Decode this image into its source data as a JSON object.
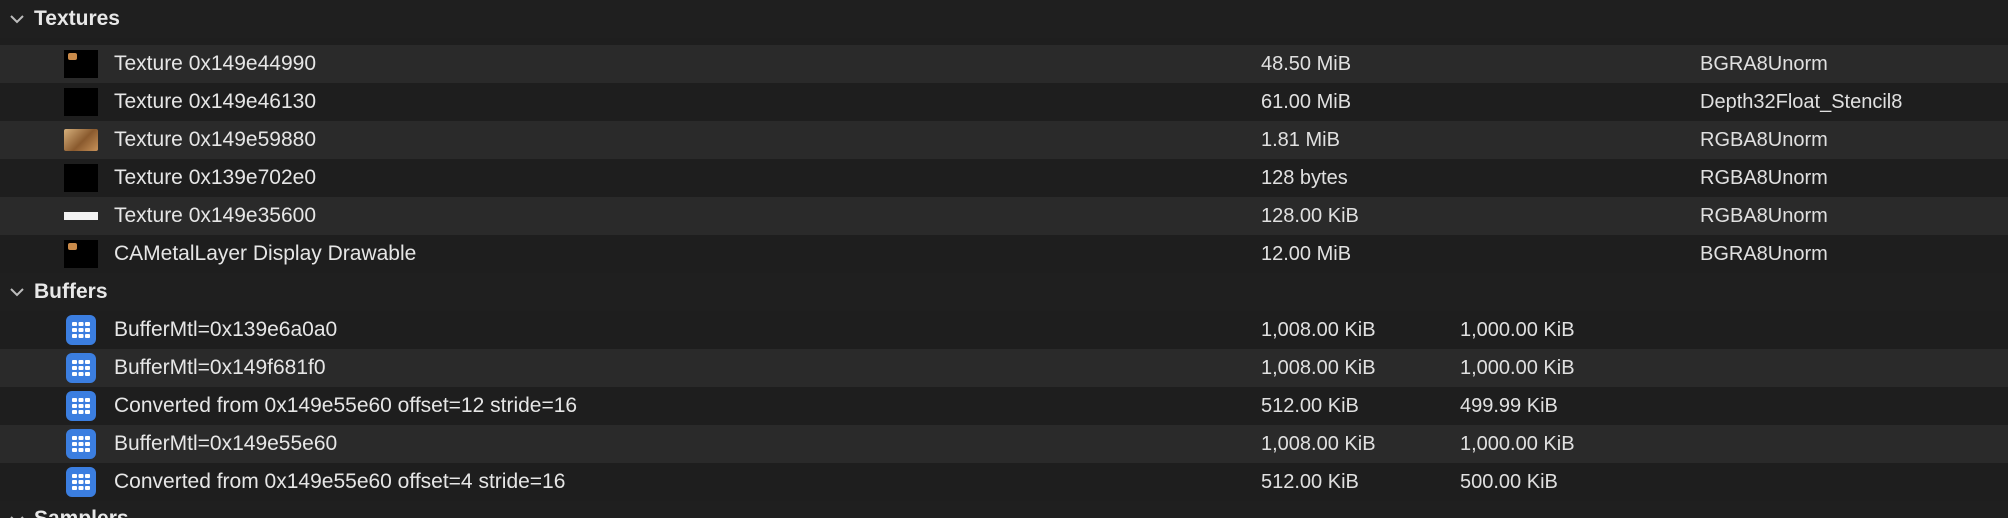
{
  "sections": {
    "textures": {
      "title": "Textures",
      "items": [
        {
          "name": "Texture 0x149e44990",
          "size": "48.50 MiB",
          "format": "BGRA8Unorm",
          "thumb": "dark-texture-thumbnail"
        },
        {
          "name": "Texture 0x149e46130",
          "size": "61.00 MiB",
          "format": "Depth32Float_Stencil8",
          "thumb": "black-texture-thumbnail"
        },
        {
          "name": "Texture 0x149e59880",
          "size": "1.81 MiB",
          "format": "RGBA8Unorm",
          "thumb": "box-texture-thumbnail"
        },
        {
          "name": "Texture 0x139e702e0",
          "size": "128 bytes",
          "format": "RGBA8Unorm",
          "thumb": "black-texture-thumbnail"
        },
        {
          "name": "Texture 0x149e35600",
          "size": "128.00 KiB",
          "format": "RGBA8Unorm",
          "thumb": "white-bar-texture-thumbnail"
        },
        {
          "name": "CAMetalLayer Display Drawable",
          "size": "12.00 MiB",
          "format": "BGRA8Unorm",
          "thumb": "dark-texture-thumbnail"
        }
      ]
    },
    "buffers": {
      "title": "Buffers",
      "items": [
        {
          "name": "BufferMtl=0x139e6a0a0",
          "size": "1,008.00 KiB",
          "used": "1,000.00 KiB",
          "icon": "buffer-grid-icon"
        },
        {
          "name": "BufferMtl=0x149f681f0",
          "size": "1,008.00 KiB",
          "used": "1,000.00 KiB",
          "icon": "buffer-grid-icon"
        },
        {
          "name": "Converted from 0x149e55e60 offset=12 stride=16",
          "size": "512.00 KiB",
          "used": "499.99 KiB",
          "icon": "buffer-grid-icon"
        },
        {
          "name": "BufferMtl=0x149e55e60",
          "size": "1,008.00 KiB",
          "used": "1,000.00 KiB",
          "icon": "buffer-grid-icon"
        },
        {
          "name": "Converted from 0x149e55e60 offset=4 stride=16",
          "size": "512.00 KiB",
          "used": "500.00 KiB",
          "icon": "buffer-grid-icon"
        }
      ]
    },
    "samplers": {
      "title": "Samplers"
    }
  },
  "colors": {
    "background": "#1e1e1e",
    "row_alt": "#2a2a2a",
    "buffer_icon": "#3b7ee0",
    "text": "#e6e6e6"
  }
}
